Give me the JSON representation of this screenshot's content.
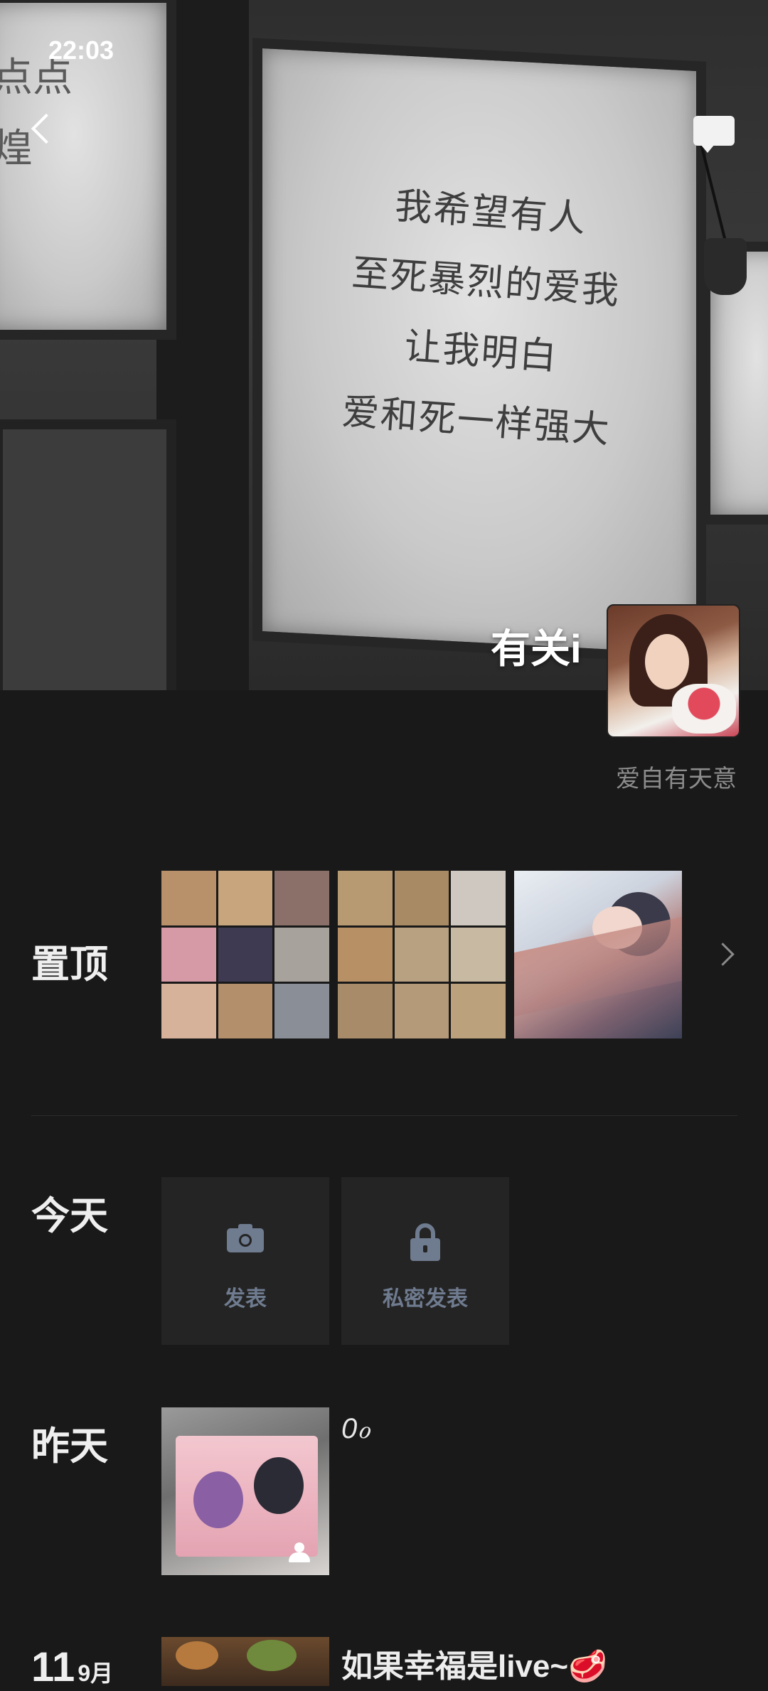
{
  "status_bar": {
    "time": "22:03"
  },
  "cover": {
    "poem_lines": [
      "我希望有人",
      "至死暴烈的爱我",
      "让我明白",
      "爱和死一样强大"
    ],
    "left_lines": [
      "点点",
      "煌"
    ]
  },
  "profile": {
    "name": "有关i",
    "signature": "爱自有天意"
  },
  "sections": {
    "pinned": {
      "label": "置顶"
    },
    "today": {
      "label": "今天",
      "actions": [
        {
          "label": "发表",
          "icon": "camera-icon"
        },
        {
          "label": "私密发表",
          "icon": "lock-icon"
        }
      ]
    },
    "yesterday": {
      "label": "昨天",
      "text": "0ℴ"
    },
    "sep11": {
      "day": "11",
      "month": "9月",
      "text": "如果幸福是live~🥩"
    }
  },
  "colors": {
    "background": "#191919",
    "tile": "#242424",
    "action_text": "#6f7b8f",
    "signature": "#8c8c8c"
  }
}
